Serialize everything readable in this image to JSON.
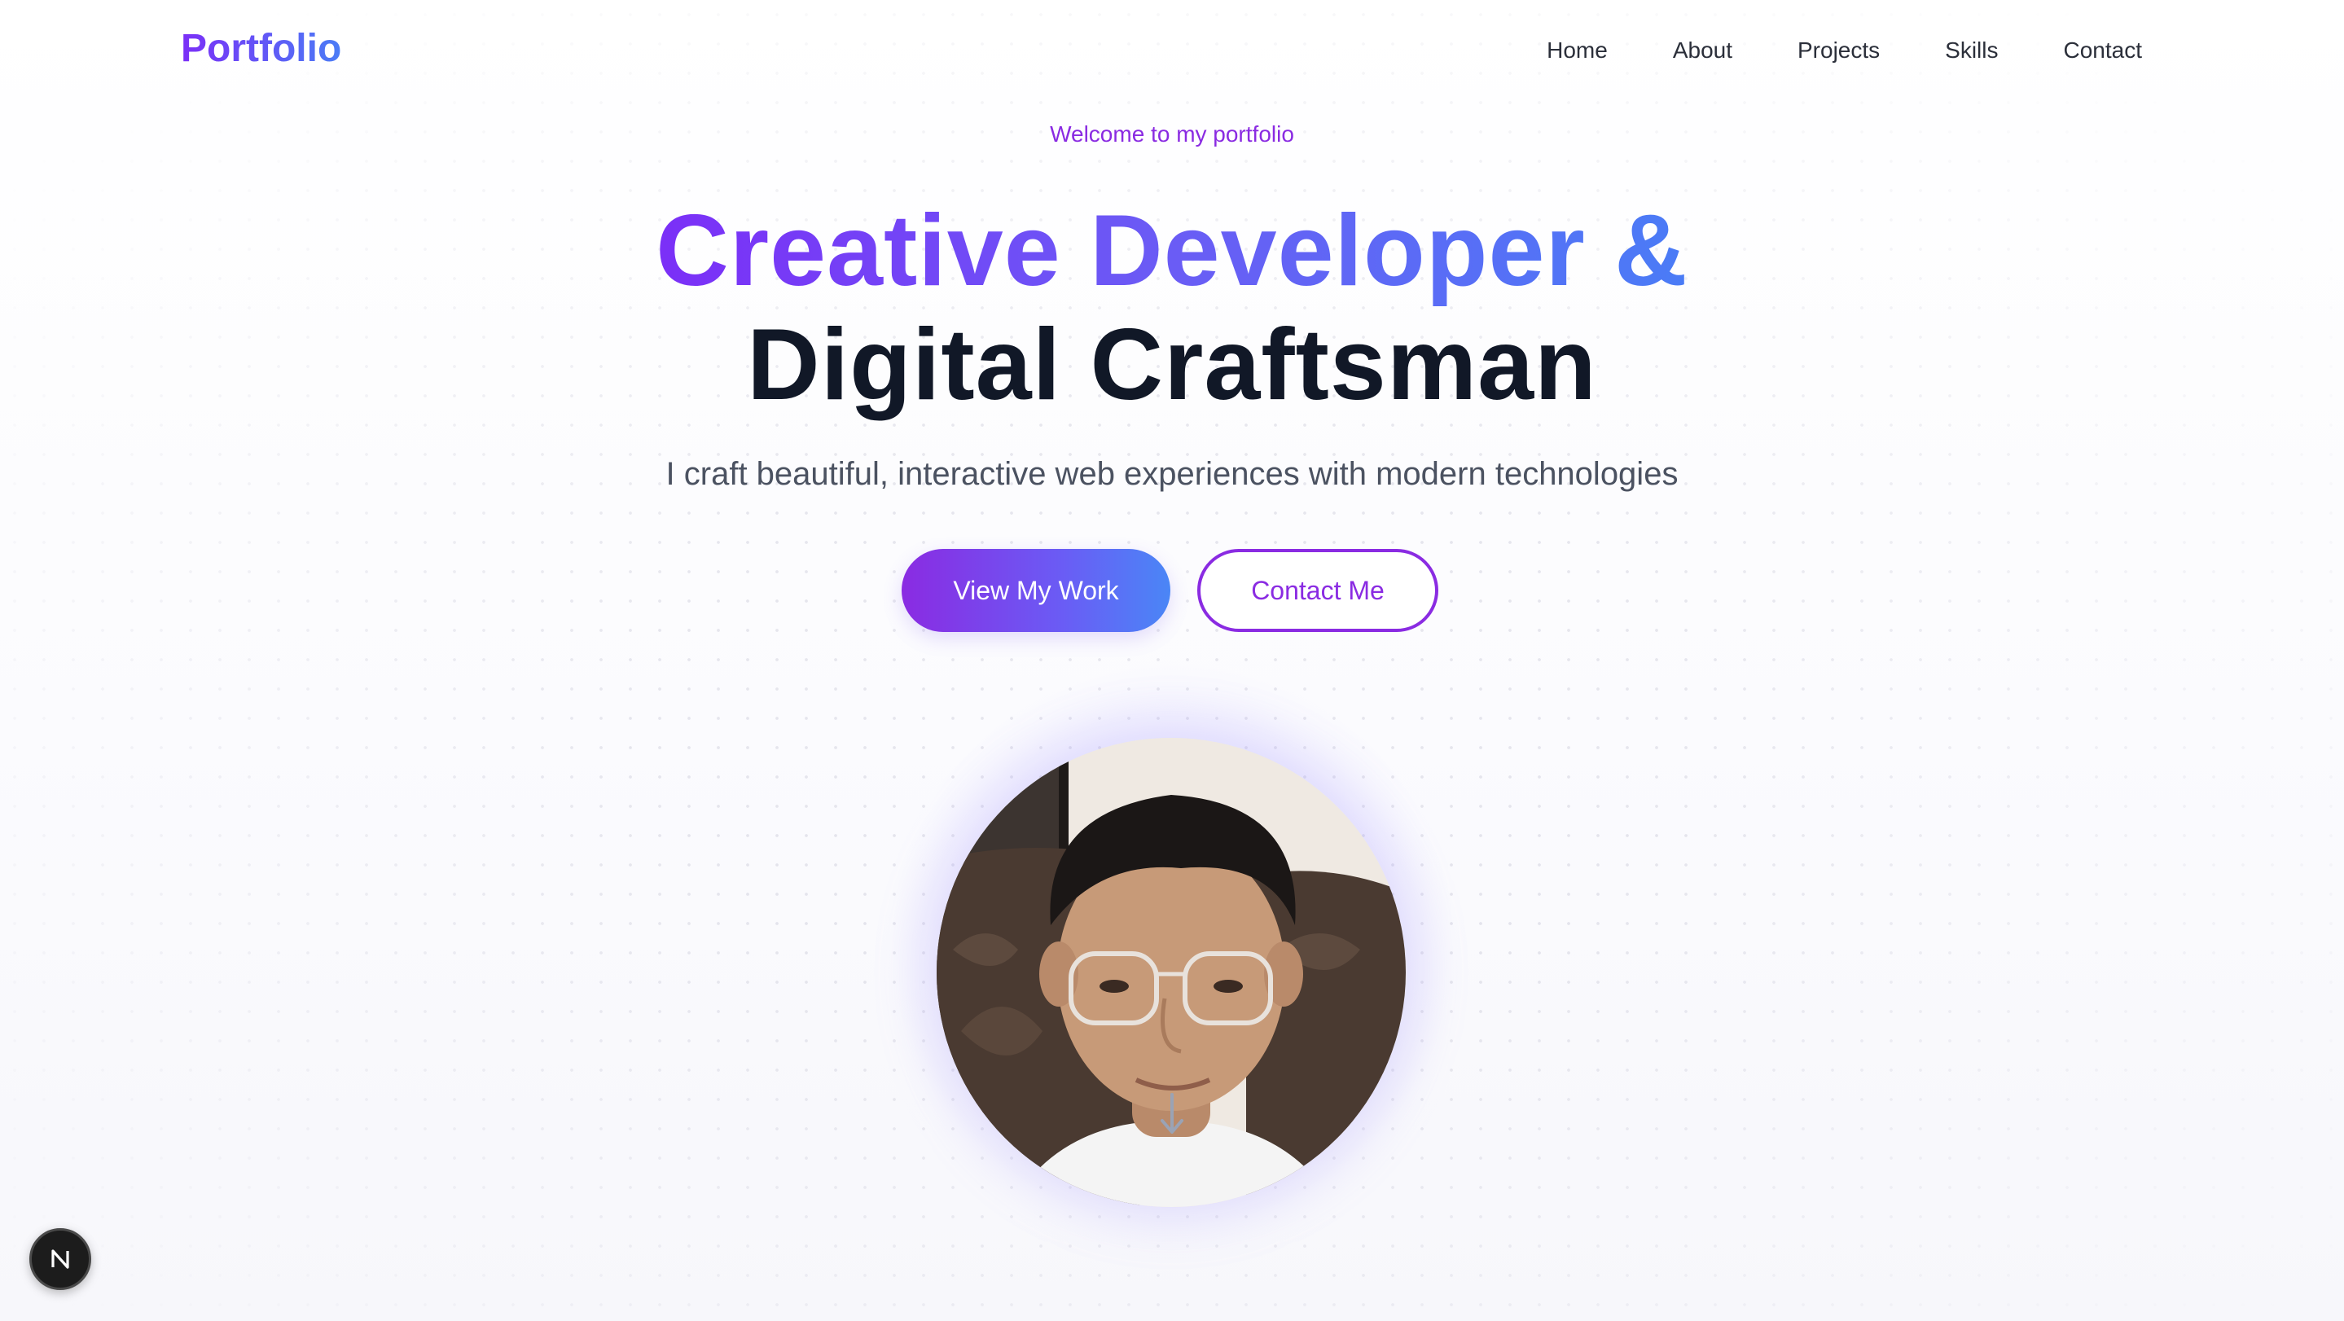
{
  "header": {
    "logo": "Portfolio",
    "nav": [
      {
        "label": "Home"
      },
      {
        "label": "About"
      },
      {
        "label": "Projects"
      },
      {
        "label": "Skills"
      },
      {
        "label": "Contact"
      }
    ]
  },
  "hero": {
    "welcome": "Welcome to my portfolio",
    "headline_line1": "Creative Developer &",
    "headline_line2": "Digital Craftsman",
    "subtitle": "I craft beautiful, interactive web experiences with modern technologies",
    "primary_button": "View My Work",
    "secondary_button": "Contact Me"
  },
  "icons": {
    "scroll": "arrow-down-icon",
    "framework_badge": "nextjs-n-icon"
  },
  "colors": {
    "accent_purple": "#8a2be2",
    "accent_blue": "#4a7cf6",
    "heading_dark": "#111827",
    "text_muted": "#4b5261"
  }
}
